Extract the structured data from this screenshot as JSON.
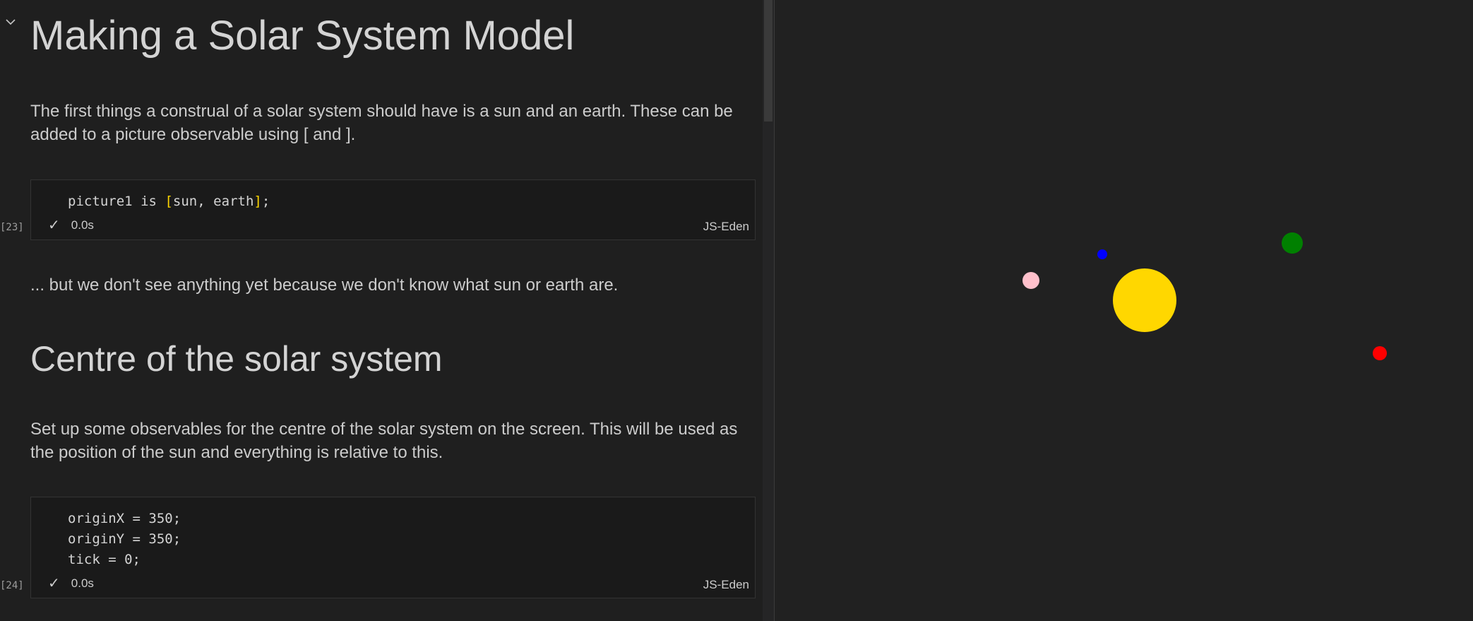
{
  "notebook": {
    "title": "Making a Solar System Model",
    "intro": "The first things a construal of a solar system should have is a sun and an earth. These can be added to a picture observable using [ and ].",
    "cells": [
      {
        "exec_count": "[23]",
        "code_lines": [
          "picture1 is [sun, earth];"
        ],
        "status_time": "0.0s",
        "language": "JS-Eden"
      },
      {
        "exec_count": "[24]",
        "code_lines": [
          "originX = 350;",
          "originY = 350;",
          "tick = 0;"
        ],
        "status_time": "0.0s",
        "language": "JS-Eden"
      }
    ],
    "after_cell_text": "... but we don't see anything yet because we don't know what sun or earth are.",
    "section_heading": "Centre of the solar system",
    "section_text": "Set up some observables for the centre of the solar system on the screen. This will be used as the position of the sun and everything is relative to this."
  },
  "canvas": {
    "bodies": [
      {
        "name": "sun",
        "color": "#ffd700"
      },
      {
        "name": "pink-planet",
        "color": "#ffc0cb"
      },
      {
        "name": "blue-planet",
        "color": "#0000ff"
      },
      {
        "name": "green-planet",
        "color": "#008000"
      },
      {
        "name": "red-planet",
        "color": "#ff0000"
      }
    ]
  },
  "icons": {
    "collapse": "chevron-down-icon",
    "status": "check-icon"
  },
  "colors": {
    "background": "#1f1f1f",
    "canvas_background": "#212121",
    "text": "#cccccc",
    "bracket_highlight": "#ffd700"
  }
}
